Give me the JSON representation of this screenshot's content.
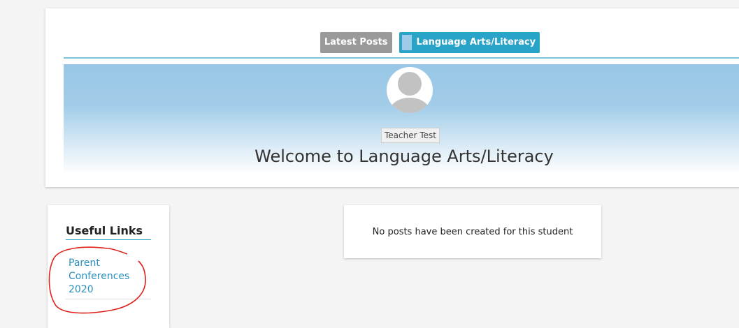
{
  "tabs": {
    "latest_posts": "Latest Posts",
    "language_arts": "Language Arts/Literacy"
  },
  "header": {
    "teacher_name": "Teacher Test",
    "welcome_text": "Welcome to Language Arts/Literacy"
  },
  "useful_links": {
    "title": "Useful Links",
    "items": [
      {
        "label": "Parent Conferences 2020"
      }
    ]
  },
  "posts": {
    "empty_message": "No posts have been created for this student"
  },
  "colors": {
    "accent": "#2aa3c8",
    "tab_inactive": "#9a9a9a",
    "banner_top": "#98c6e6",
    "link": "#2a8fbf",
    "annotation_red": "#e0201b"
  },
  "icons": {
    "avatar": "user-avatar-icon"
  }
}
